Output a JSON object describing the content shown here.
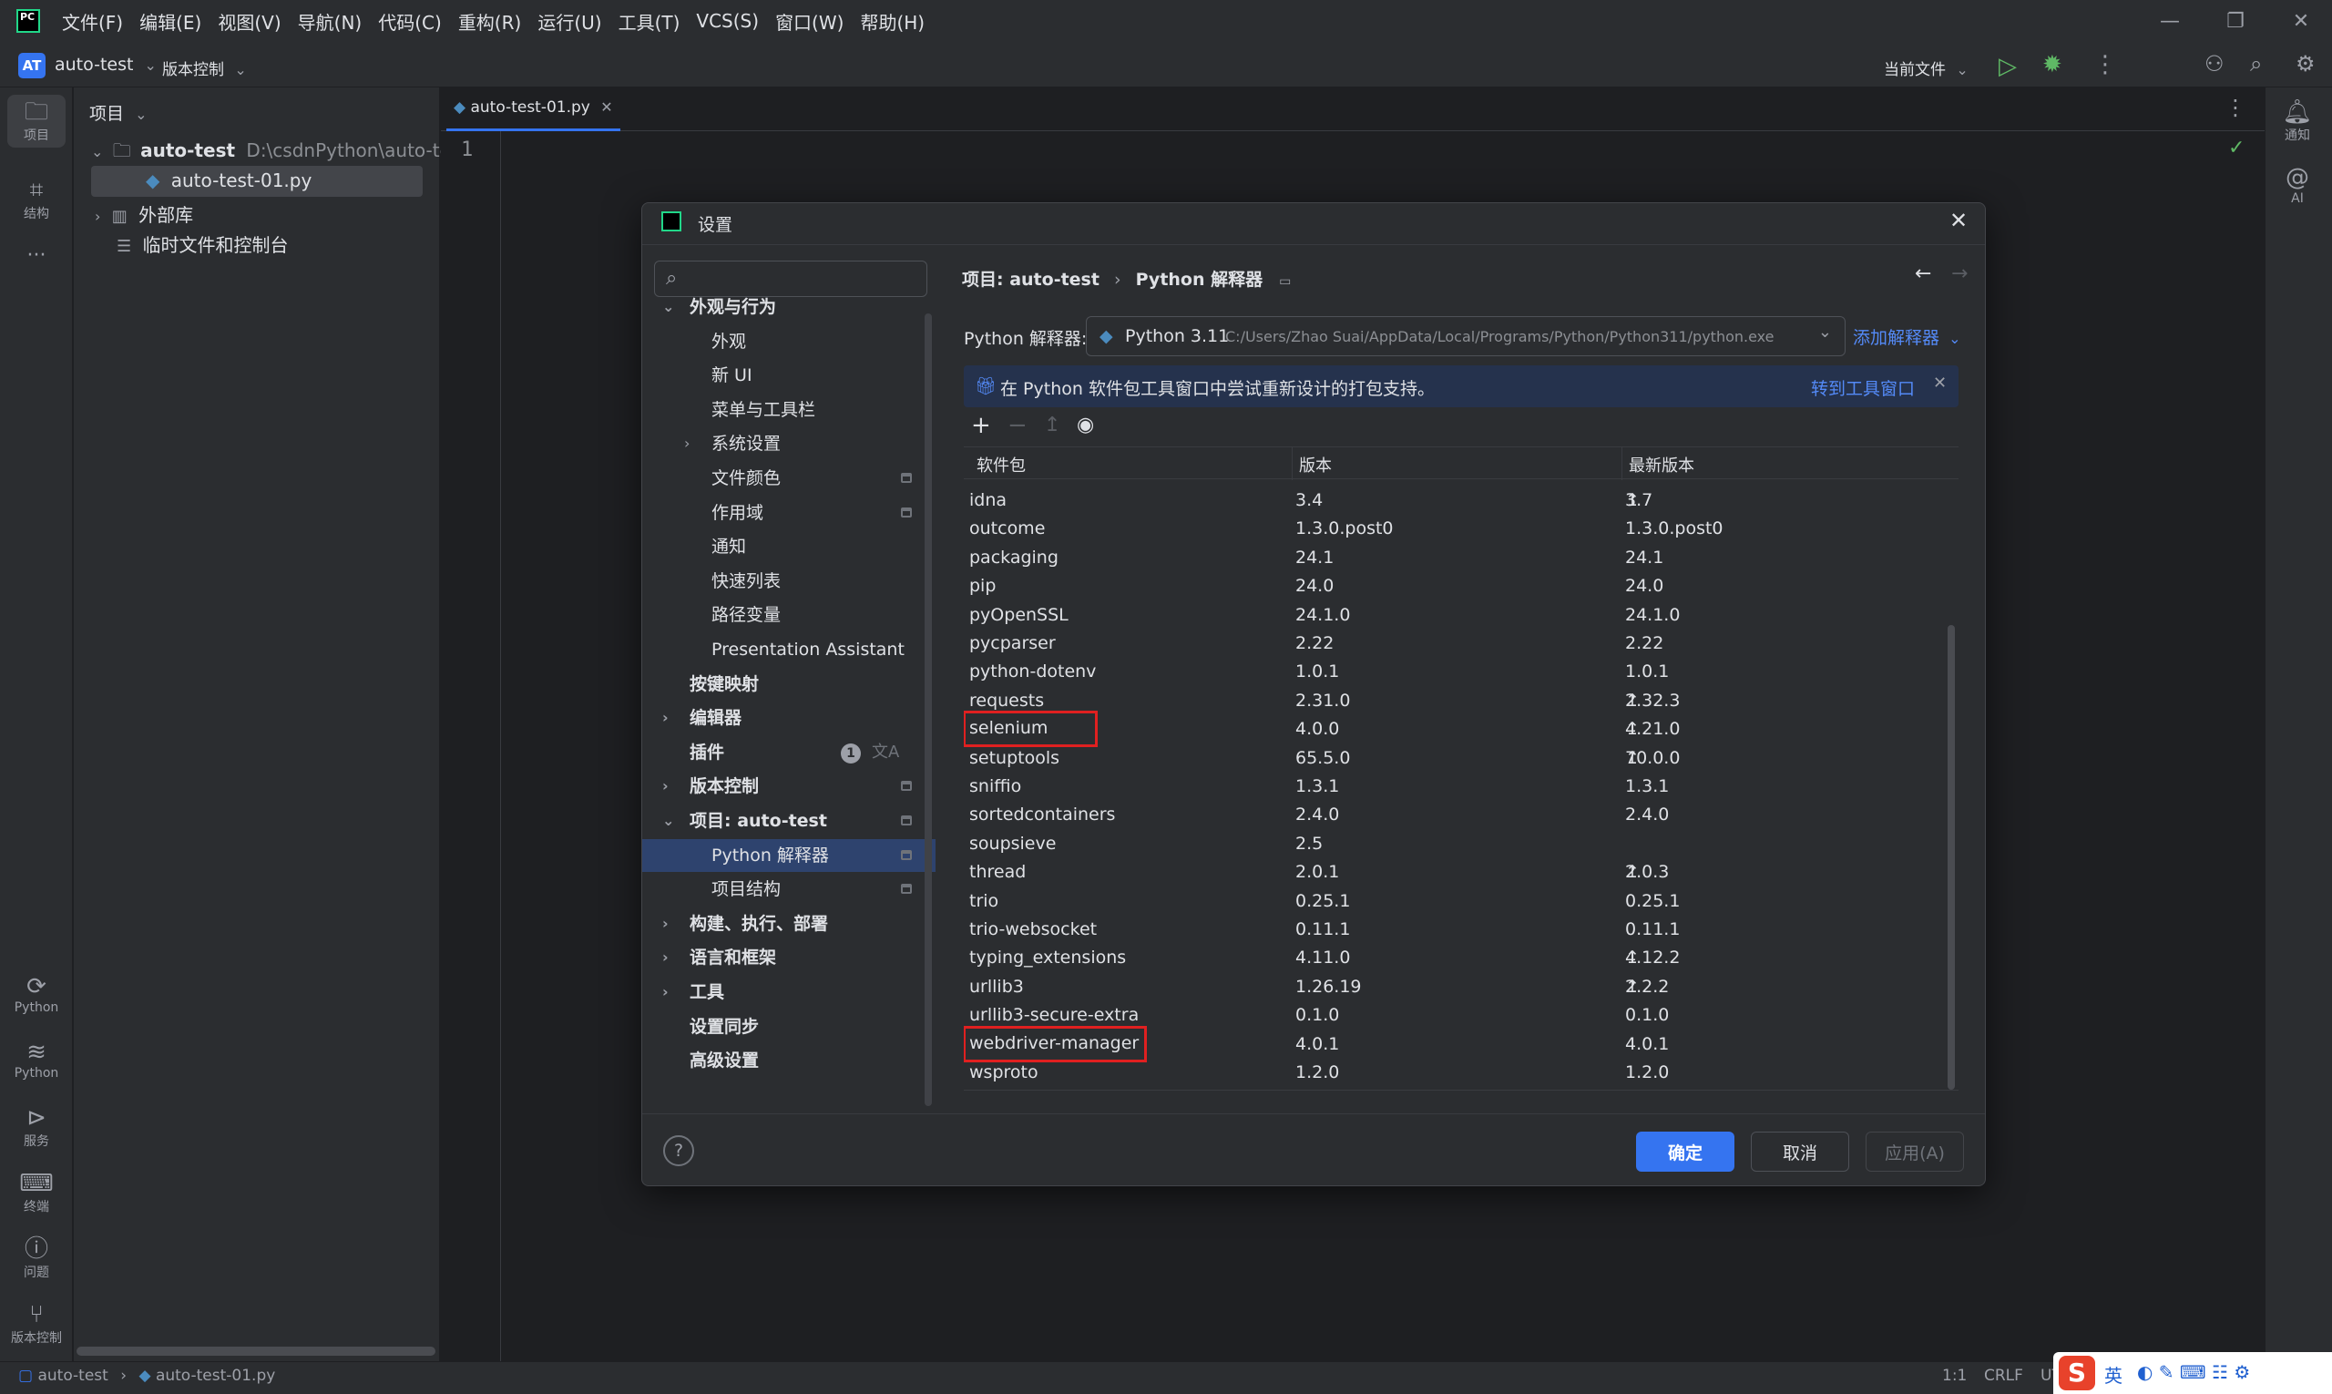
{
  "menubar": {
    "items": [
      "文件(F)",
      "编辑(E)",
      "视图(V)",
      "导航(N)",
      "代码(C)",
      "重构(R)",
      "运行(U)",
      "工具(T)",
      "VCS(S)",
      "窗口(W)",
      "帮助(H)"
    ]
  },
  "toolbar": {
    "project_badge": "AT",
    "project_name": "auto-test",
    "vcs_label": "版本控制",
    "run_config": "当前文件"
  },
  "left_strip": {
    "project": "项目",
    "structure": "结构",
    "python_console": "Python",
    "python_packages": "Python",
    "services": "服务",
    "terminal": "终端",
    "problems": "问题",
    "vcs": "版本控制"
  },
  "project_panel": {
    "title": "项目",
    "root_name": "auto-test",
    "root_path": "D:\\csdnPython\\auto-test",
    "file": "auto-test-01.py",
    "external_libs": "外部库",
    "scratches": "临时文件和控制台"
  },
  "editor": {
    "tab_label": "auto-test-01.py",
    "line_number": "1"
  },
  "right_strip": {
    "notifications": "通知",
    "ai": "AI"
  },
  "dialog": {
    "title": "设置",
    "breadcrumb_project": "项目: auto-test",
    "breadcrumb_sep": "›",
    "breadcrumb_page": "Python 解释器",
    "interpreter_label": "Python 解释器:",
    "interpreter_name": "Python 3.11",
    "interpreter_path": "C:/Users/Zhao Suai/AppData/Local/Programs/Python/Python311/python.exe",
    "add_interpreter": "添加解释器",
    "banner_text": "在 Python 软件包工具窗口中尝试重新设计的打包支持。",
    "banner_link": "转到工具窗口",
    "ok": "确定",
    "cancel": "取消",
    "apply": "应用(A)",
    "help": "?"
  },
  "settings_nav": [
    {
      "label": "外观与行为",
      "bold": true,
      "expanded": true
    },
    {
      "label": "外观"
    },
    {
      "label": "新 UI"
    },
    {
      "label": "菜单与工具栏"
    },
    {
      "label": "系统设置",
      "collapsed": true
    },
    {
      "label": "文件颜色",
      "pin": true
    },
    {
      "label": "作用域",
      "pin": true
    },
    {
      "label": "通知"
    },
    {
      "label": "快速列表"
    },
    {
      "label": "路径变量"
    },
    {
      "label": "Presentation Assistant"
    },
    {
      "label": "按键映射",
      "bold": true
    },
    {
      "label": "编辑器",
      "bold": true,
      "collapsed": true
    },
    {
      "label": "插件",
      "bold": true,
      "badge": "1"
    },
    {
      "label": "版本控制",
      "bold": true,
      "collapsed": true,
      "pin": true
    },
    {
      "label": "项目: auto-test",
      "bold": true,
      "expanded": true,
      "pin": true
    },
    {
      "label": "Python 解释器",
      "selected": true,
      "pin": true
    },
    {
      "label": "项目结构",
      "pin": true
    },
    {
      "label": "构建、执行、部署",
      "bold": true,
      "collapsed": true
    },
    {
      "label": "语言和框架",
      "bold": true,
      "collapsed": true
    },
    {
      "label": "工具",
      "bold": true,
      "collapsed": true
    },
    {
      "label": "设置同步",
      "bold": true
    },
    {
      "label": "高级设置",
      "bold": true
    }
  ],
  "packages": {
    "headers": [
      "软件包",
      "版本",
      "最新版本"
    ],
    "rows": [
      {
        "name": "idna",
        "version": "3.4",
        "latest": "3.7",
        "upgrade": true
      },
      {
        "name": "outcome",
        "version": "1.3.0.post0",
        "latest": "1.3.0.post0"
      },
      {
        "name": "packaging",
        "version": "24.1",
        "latest": "24.1"
      },
      {
        "name": "pip",
        "version": "24.0",
        "latest": "24.0"
      },
      {
        "name": "pyOpenSSL",
        "version": "24.1.0",
        "latest": "24.1.0"
      },
      {
        "name": "pycparser",
        "version": "2.22",
        "latest": "2.22"
      },
      {
        "name": "python-dotenv",
        "version": "1.0.1",
        "latest": "1.0.1"
      },
      {
        "name": "requests",
        "version": "2.31.0",
        "latest": "2.32.3",
        "upgrade": true
      },
      {
        "name": "selenium",
        "version": "4.0.0",
        "latest": "4.21.0",
        "upgrade": true,
        "highlight": true
      },
      {
        "name": "setuptools",
        "version": "65.5.0",
        "latest": "70.0.0",
        "upgrade": true
      },
      {
        "name": "sniffio",
        "version": "1.3.1",
        "latest": "1.3.1"
      },
      {
        "name": "sortedcontainers",
        "version": "2.4.0",
        "latest": "2.4.0"
      },
      {
        "name": "soupsieve",
        "version": "2.5",
        "latest": ""
      },
      {
        "name": "thread",
        "version": "2.0.1",
        "latest": "2.0.3",
        "upgrade": true
      },
      {
        "name": "trio",
        "version": "0.25.1",
        "latest": "0.25.1"
      },
      {
        "name": "trio-websocket",
        "version": "0.11.1",
        "latest": "0.11.1"
      },
      {
        "name": "typing_extensions",
        "version": "4.11.0",
        "latest": "4.12.2",
        "upgrade": true
      },
      {
        "name": "urllib3",
        "version": "1.26.19",
        "latest": "2.2.2",
        "upgrade": true
      },
      {
        "name": "urllib3-secure-extra",
        "version": "0.1.0",
        "latest": "0.1.0"
      },
      {
        "name": "webdriver-manager",
        "version": "4.0.1",
        "latest": "4.0.1",
        "highlight": true
      },
      {
        "name": "wsproto",
        "version": "1.2.0",
        "latest": "1.2.0"
      }
    ]
  },
  "statusbar": {
    "project": "auto-test",
    "file": "auto-test-01.py",
    "position": "1:1",
    "line_sep": "CRLF",
    "encoding": "UTF-8"
  },
  "colors": {
    "accent": "#3574f0",
    "highlight_box": "#e02020",
    "selection": "#2e436e",
    "banner": "#25324d"
  }
}
